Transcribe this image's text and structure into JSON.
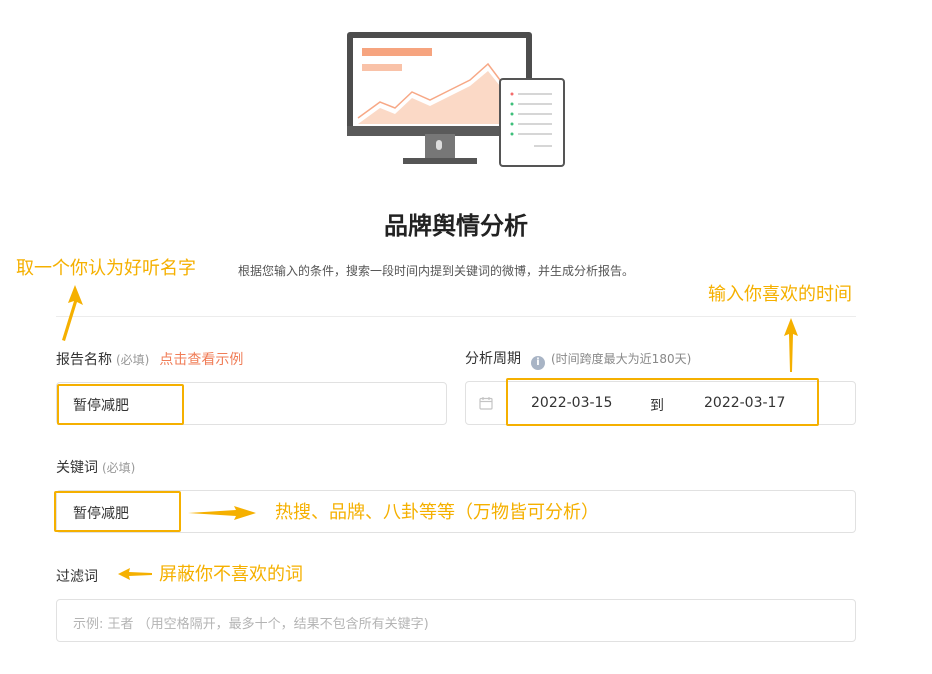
{
  "title": "品牌舆情分析",
  "subtitle": "根据您输入的条件，搜索一段时间内提到关键词的微博，并生成分析报告。",
  "report_name": {
    "label": "报告名称",
    "required": "(必填)",
    "example_link": "点击查看示例",
    "value": "暂停减肥"
  },
  "period": {
    "label": "分析周期",
    "hint": "(时间跨度最大为近180天)",
    "info_icon": "info-icon",
    "calendar_icon": "calendar-icon",
    "start": "2022-03-15",
    "separator": "到",
    "end": "2022-03-17"
  },
  "keyword": {
    "label": "关键词",
    "required": "(必填)",
    "value": "暂停减肥"
  },
  "filter": {
    "label": "过滤词",
    "placeholder": "示例: 王者 （用空格隔开，最多十个，结果不包含所有关键字)"
  },
  "annotations": {
    "name_tip": "取一个你认为好听名字",
    "time_tip": "输入你喜欢的时间",
    "keyword_tip": "热搜、品牌、八卦等等（万物皆可分析）",
    "filter_tip": "屏蔽你不喜欢的词",
    "color": "#f5b000"
  },
  "colors": {
    "accent": "#f07d57",
    "annotation": "#f5b000"
  }
}
